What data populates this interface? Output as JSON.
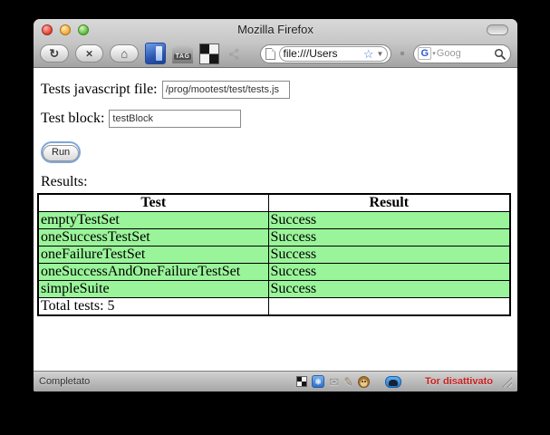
{
  "window": {
    "title": "Mozilla Firefox"
  },
  "toolbar": {
    "url_value": "file:///Users",
    "search_text": "Goog",
    "google_logo": "G",
    "tag_label": "TAG"
  },
  "icons": {
    "reload": "↻",
    "stop": "×",
    "home": "⌂",
    "star": "☆",
    "dropdown": "▼",
    "small_dropdown": "▾",
    "snowflake": "❄",
    "mail": "✉",
    "pencil": "✎"
  },
  "page": {
    "file_label": "Tests javascript file:",
    "file_value": "/prog/mootest/test/tests.js",
    "block_label": "Test block:",
    "block_value": "testBlock",
    "run_label": "Run",
    "results_label": "Results:",
    "table": {
      "headers": [
        "Test",
        "Result"
      ],
      "rows": [
        {
          "test": "emptyTestSet",
          "result": "Success"
        },
        {
          "test": "oneSuccessTestSet",
          "result": "Success"
        },
        {
          "test": "oneFailureTestSet",
          "result": "Success"
        },
        {
          "test": "oneSuccessAndOneFailureTestSet",
          "result": "Success"
        },
        {
          "test": "simpleSuite",
          "result": "Success"
        }
      ],
      "footer": "Total tests: 5"
    }
  },
  "statusbar": {
    "status": "Completato",
    "tor": "Tor disattivato"
  },
  "colors": {
    "row_green": "#9af49a",
    "tor_red": "#cc1f1f",
    "accent_blue": "#4a7ad6"
  }
}
